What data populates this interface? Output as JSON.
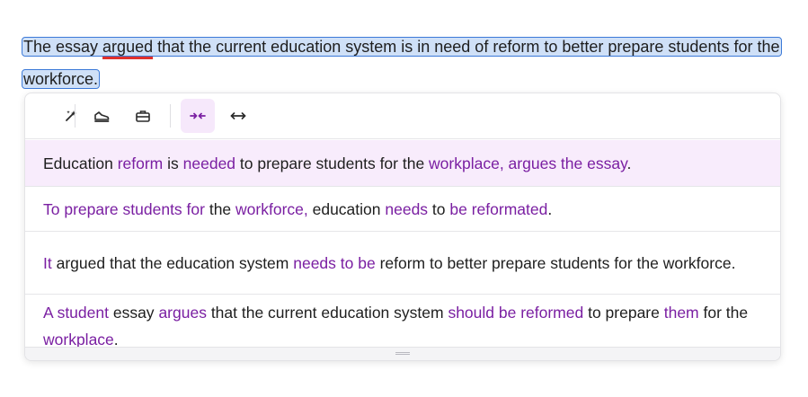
{
  "document": {
    "before_error": "The essay ",
    "error_word": "argued",
    "after_error": " that the current education system is in need of reform to better prepare students for the workforce."
  },
  "toolbar": {
    "buttons": [
      {
        "name": "magic-sparkle-icon",
        "active": false
      },
      {
        "name": "casual-shoe-icon",
        "active": false
      },
      {
        "name": "formal-briefcase-icon",
        "active": false
      },
      {
        "name": "shorten-icon",
        "active": true
      },
      {
        "name": "expand-icon",
        "active": false
      }
    ],
    "accent_color": "#7a1fa2"
  },
  "suggestions": [
    {
      "segments": [
        {
          "t": "Education ",
          "c": false
        },
        {
          "t": "reform",
          "c": true
        },
        {
          "t": " is ",
          "c": false
        },
        {
          "t": "needed",
          "c": true
        },
        {
          "t": " to prepare students for the ",
          "c": false
        },
        {
          "t": "workplace, argues the essay",
          "c": true
        },
        {
          "t": ".",
          "c": false
        }
      ]
    },
    {
      "segments": [
        {
          "t": "To prepare students for",
          "c": true
        },
        {
          "t": " the ",
          "c": false
        },
        {
          "t": "workforce,",
          "c": true
        },
        {
          "t": " education ",
          "c": false
        },
        {
          "t": "needs",
          "c": true
        },
        {
          "t": " to ",
          "c": false
        },
        {
          "t": "be reformated",
          "c": true
        },
        {
          "t": ".",
          "c": false
        }
      ]
    },
    {
      "segments": [
        {
          "t": "It",
          "c": true
        },
        {
          "t": " argued that the education system ",
          "c": false
        },
        {
          "t": "needs to be",
          "c": true
        },
        {
          "t": " reform to better prepare students for the workforce.",
          "c": false
        }
      ]
    },
    {
      "segments": [
        {
          "t": "A student",
          "c": true
        },
        {
          "t": " essay ",
          "c": false
        },
        {
          "t": "argues",
          "c": true
        },
        {
          "t": " that the current education system ",
          "c": false
        },
        {
          "t": "should be reformed",
          "c": true
        },
        {
          "t": " to prepare ",
          "c": false
        },
        {
          "t": "them",
          "c": true
        },
        {
          "t": " for the ",
          "c": false
        },
        {
          "t": "workplace",
          "c": true
        },
        {
          "t": ".",
          "c": false
        }
      ]
    }
  ]
}
